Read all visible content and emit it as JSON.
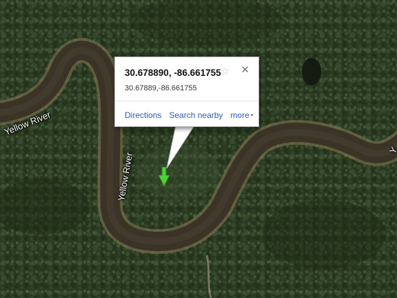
{
  "map": {
    "labels": {
      "river_left": "Yellow River",
      "river_center": "Yellow River",
      "river_right": "Y"
    },
    "colors": {
      "forest": "#2a3d22",
      "river": "#3a3326",
      "sandbar": "#8a7a58",
      "marker": "#4fcf3a"
    }
  },
  "infowindow": {
    "title": "30.678890, -86.661755",
    "coordinates": "30.67889,-86.661755",
    "star_icon": "☆",
    "close_icon": "✕",
    "links": {
      "directions": "Directions",
      "search_nearby": "Search nearby",
      "more": "more",
      "more_caret": "▾"
    }
  }
}
